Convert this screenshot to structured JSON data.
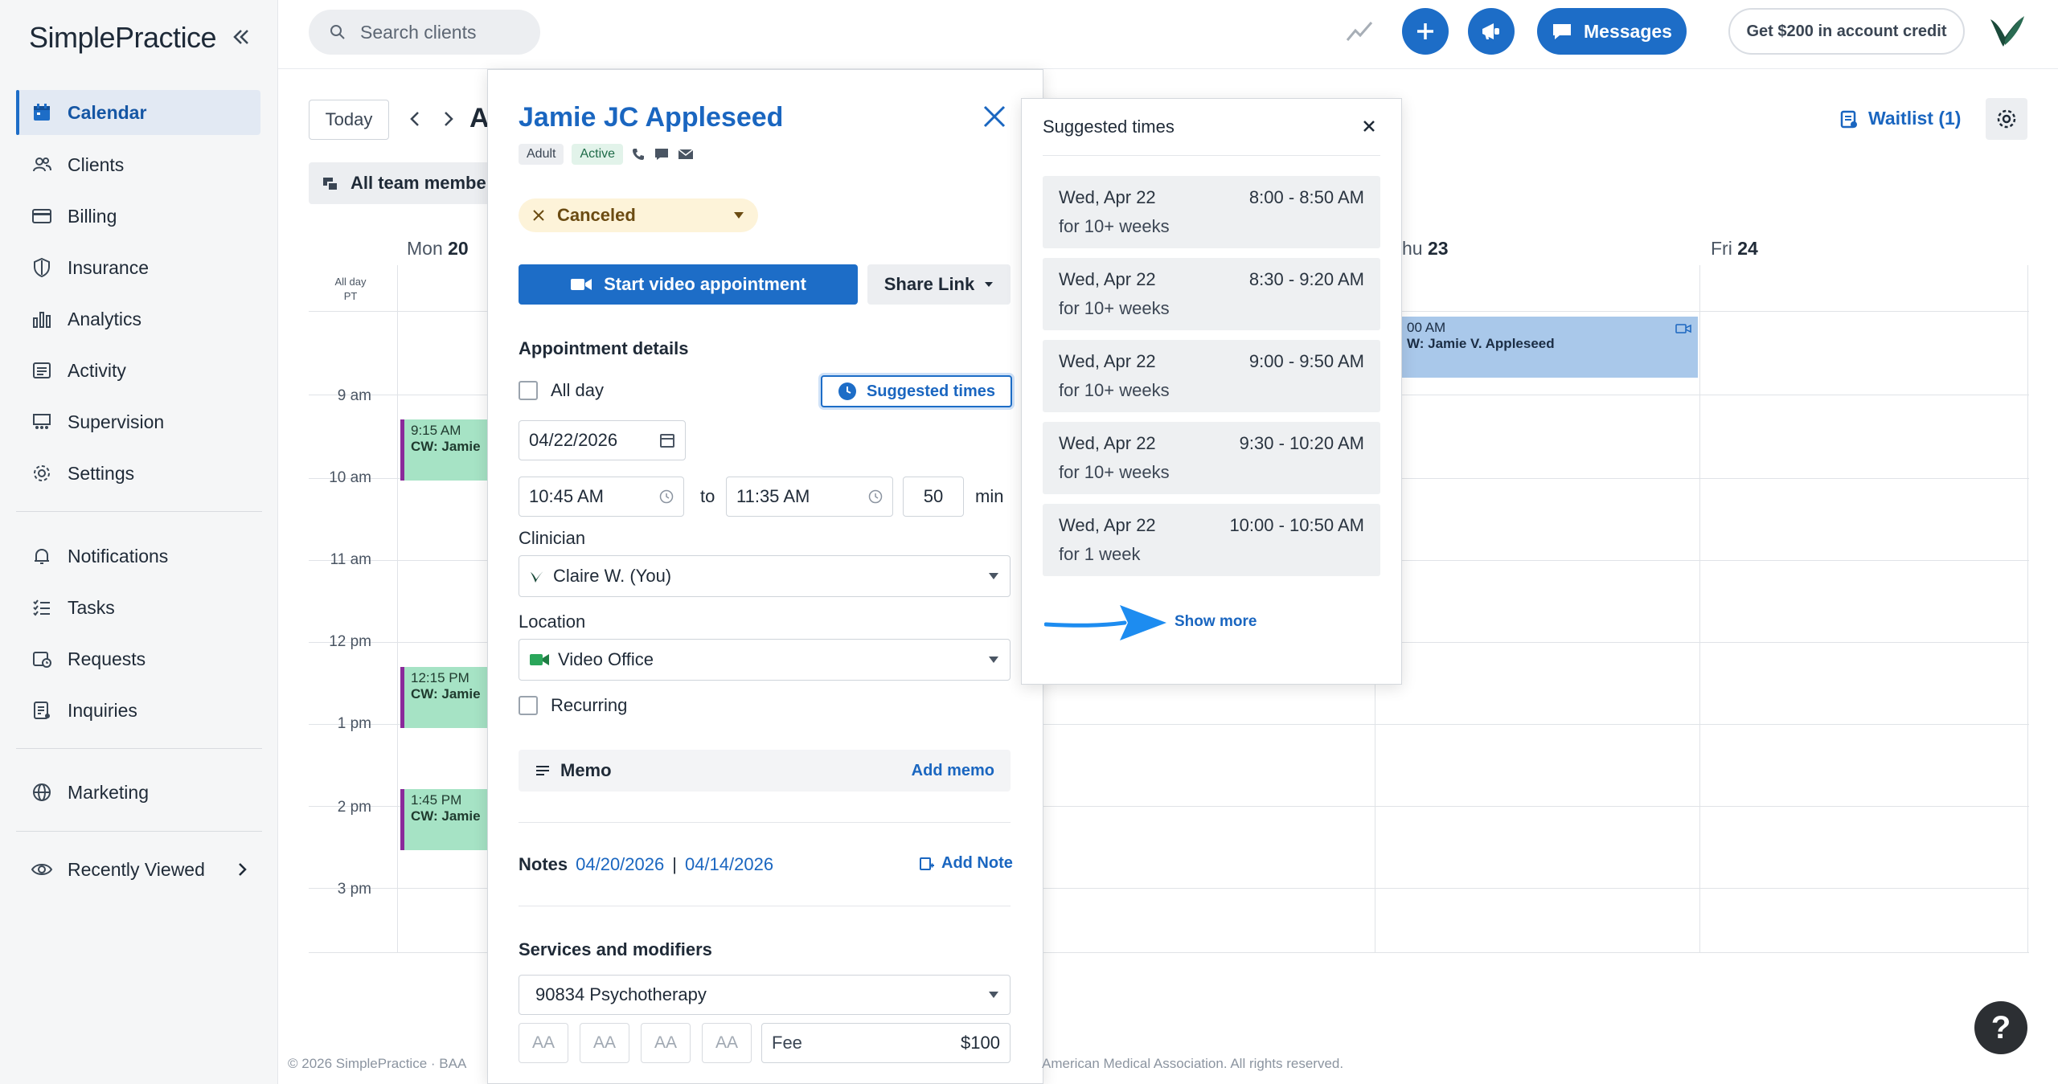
{
  "app": {
    "logo": "SimplePractice"
  },
  "sidebar": {
    "items": [
      {
        "label": "Calendar"
      },
      {
        "label": "Clients"
      },
      {
        "label": "Billing"
      },
      {
        "label": "Insurance"
      },
      {
        "label": "Analytics"
      },
      {
        "label": "Activity"
      },
      {
        "label": "Supervision"
      },
      {
        "label": "Settings"
      },
      {
        "label": "Notifications"
      },
      {
        "label": "Tasks"
      },
      {
        "label": "Requests"
      },
      {
        "label": "Inquiries"
      },
      {
        "label": "Marketing"
      },
      {
        "label": "Recently Viewed"
      }
    ]
  },
  "topbar": {
    "search_placeholder": "Search clients",
    "messages_label": "Messages",
    "credit_label": "Get $200 in account credit"
  },
  "calendar": {
    "today": "Today",
    "header_letter": "A",
    "team_filter": "All team membe",
    "waitlist": "Waitlist (1)",
    "allday": "All day",
    "tz": "PT",
    "days": [
      {
        "name": "Mon",
        "num": "20"
      },
      {
        "name": "hu",
        "num": "23"
      },
      {
        "name": "Fri",
        "num": "24"
      }
    ],
    "times": [
      "9 am",
      "10 am",
      "11 am",
      "12 pm",
      "1 pm",
      "2 pm",
      "3 pm"
    ],
    "events": [
      {
        "time": "9:15 AM",
        "title": "CW: Jamie"
      },
      {
        "time": "12:15 PM",
        "title": "CW: Jamie"
      },
      {
        "time": "1:45 PM",
        "title": "CW: Jamie"
      },
      {
        "time": "00 AM",
        "title": "W: Jamie V. Appleseed"
      }
    ]
  },
  "appointment": {
    "client_name": "Jamie JC Appleseed",
    "chip_adult": "Adult",
    "chip_active": "Active",
    "status": "Canceled",
    "start_video": "Start video appointment",
    "share_link": "Share Link",
    "details_title": "Appointment details",
    "all_day": "All day",
    "suggested_times_btn": "Suggested times",
    "date": "04/22/2026",
    "start_time": "10:45 AM",
    "to": "to",
    "end_time": "11:35 AM",
    "duration": "50",
    "min": "min",
    "clinician_label": "Clinician",
    "clinician": "Claire W. (You)",
    "location_label": "Location",
    "location": "Video Office",
    "recurring": "Recurring",
    "memo": "Memo",
    "add_memo": "Add memo",
    "notes_label": "Notes",
    "note_date_1": "04/20/2026",
    "note_sep": "|",
    "note_date_2": "04/14/2026",
    "add_note": "Add Note",
    "services_title": "Services and modifiers",
    "service": "90834 Psychotherapy",
    "modifier_placeholder": "AA",
    "fee_label": "Fee",
    "fee_value": "$100"
  },
  "suggested": {
    "title": "Suggested times",
    "slots": [
      {
        "day": "Wed, Apr 22",
        "time": "8:00 - 8:50 AM",
        "freq": "for 10+ weeks"
      },
      {
        "day": "Wed, Apr 22",
        "time": "8:30 - 9:20 AM",
        "freq": "for 10+ weeks"
      },
      {
        "day": "Wed, Apr 22",
        "time": "9:00 - 9:50 AM",
        "freq": "for 10+ weeks"
      },
      {
        "day": "Wed, Apr 22",
        "time": "9:30 - 10:20 AM",
        "freq": "for 10+ weeks"
      },
      {
        "day": "Wed, Apr 22",
        "time": "10:00 - 10:50 AM",
        "freq": "for 1 week"
      }
    ],
    "show_more": "Show more"
  },
  "footer": {
    "left": "© 2026 SimplePractice · BAA",
    "right": "American Medical Association. All rights reserved."
  },
  "help": "?",
  "colors": {
    "brand": "#1d6dc7",
    "event_green": "#a6e3c5",
    "event_blue": "#a9c8ea",
    "canceled_bg": "#fdf3d9"
  }
}
